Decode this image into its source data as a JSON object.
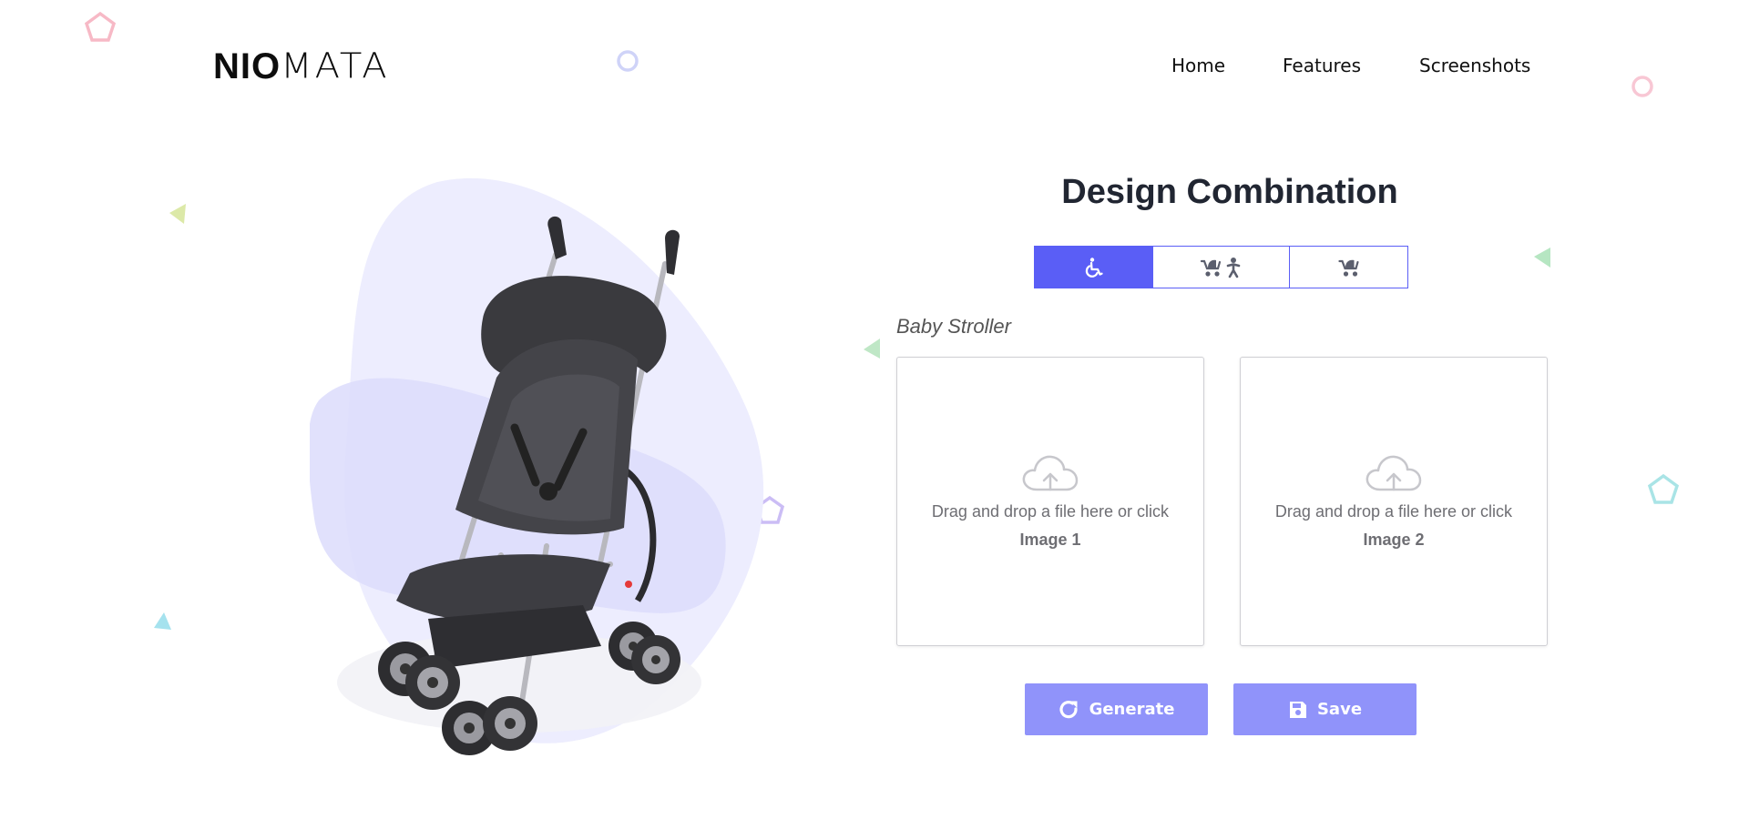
{
  "logo": {
    "bold": "NIO",
    "thin": "MATA"
  },
  "nav": {
    "items": [
      "Home",
      "Features",
      "Screenshots"
    ]
  },
  "main": {
    "title": "Design Combination",
    "tabs": [
      {
        "icon": "wheelchair-icon",
        "active": true
      },
      {
        "icon": "stroller-baby-icon",
        "active": false
      },
      {
        "icon": "stroller-icon",
        "active": false
      }
    ],
    "category": "Baby Stroller",
    "uploads": [
      {
        "message": "Drag and drop a file here or click",
        "label": "Image 1"
      },
      {
        "message": "Drag and drop a file here or click",
        "label": "Image 2"
      }
    ],
    "buttons": {
      "generate": "Generate",
      "save": "Save"
    }
  },
  "colors": {
    "accent": "#5a5ef6",
    "button": "#9093fa",
    "blob": "#ededfe",
    "blob_dark": "#dcdcfb"
  }
}
